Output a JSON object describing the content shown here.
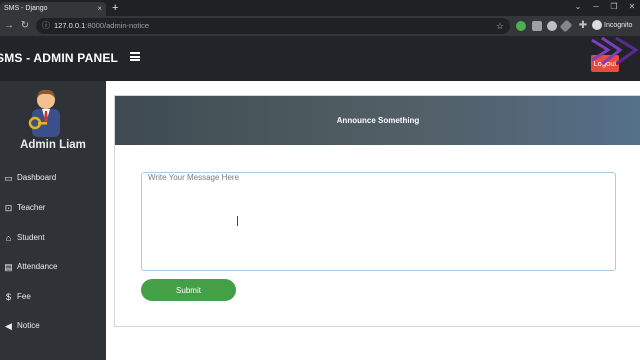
{
  "browser": {
    "tab_title": "SMS - Django",
    "tab_close": "×",
    "new_tab": "+",
    "url_host": "127.0.0.1",
    "url_rest": ":8000/admin-notice",
    "incognito_label": "Incognito",
    "controls": {
      "minimize": "⌄",
      "restore": "─",
      "maximize": "❐",
      "close": "✕"
    }
  },
  "header": {
    "brand": "SMS - ADMIN PANEL",
    "logout_label": "Logout"
  },
  "sidebar": {
    "admin_name": "Admin Liam",
    "items": [
      {
        "label": "Dashboard",
        "icon": "monitor-icon",
        "glyph": "▭"
      },
      {
        "label": "Teacher",
        "icon": "chalkboard-teacher-icon",
        "glyph": "⊡"
      },
      {
        "label": "Student",
        "icon": "graduation-cap-icon",
        "glyph": "⌂"
      },
      {
        "label": "Attendance",
        "icon": "id-card-icon",
        "glyph": "▤"
      },
      {
        "label": "Fee",
        "icon": "dollar-icon",
        "glyph": "$"
      },
      {
        "label": "Notice",
        "icon": "bullhorn-icon",
        "glyph": "◀"
      }
    ]
  },
  "main": {
    "card_title": "Announce Something",
    "message_placeholder": "Write Your Message Here",
    "message_value": "",
    "submit_label": "Submit"
  },
  "colors": {
    "header_bg": "#222429",
    "sidebar_bg": "#2f3237",
    "logout": "#e74c3c",
    "submit": "#43a047",
    "input_border": "#a9cde4"
  }
}
